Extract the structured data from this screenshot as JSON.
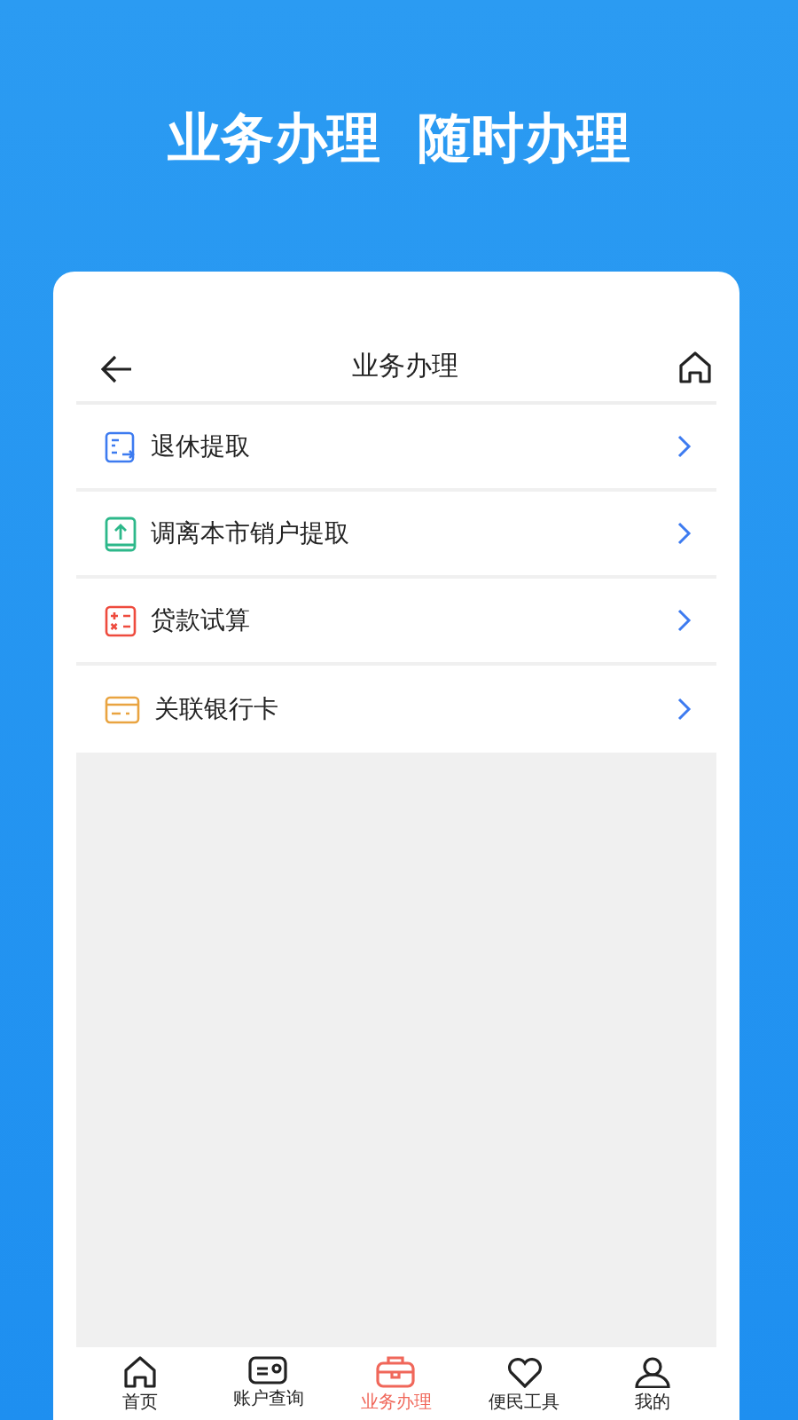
{
  "headline": "业务办理  随时办理",
  "nav": {
    "title": "业务办理"
  },
  "items": [
    {
      "label": "退休提取",
      "kind": "retire"
    },
    {
      "label": "调离本市销户提取",
      "kind": "transfer"
    },
    {
      "label": "贷款试算",
      "kind": "calc"
    },
    {
      "label": "关联银行卡",
      "kind": "card"
    }
  ],
  "tabs": [
    {
      "label": "首页",
      "kind": "home",
      "selected": false
    },
    {
      "label": "账户查询",
      "kind": "account",
      "selected": false
    },
    {
      "label": "业务办理",
      "kind": "briefcase",
      "selected": true
    },
    {
      "label": "便民工具",
      "kind": "heart",
      "selected": false
    },
    {
      "label": "我的",
      "kind": "person",
      "selected": false
    }
  ]
}
